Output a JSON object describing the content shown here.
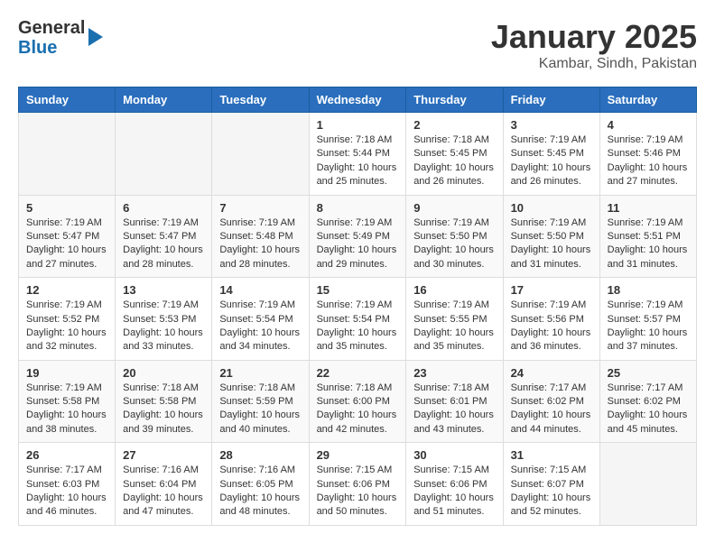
{
  "header": {
    "logo_general": "General",
    "logo_blue": "Blue",
    "title": "January 2025",
    "subtitle": "Kambar, Sindh, Pakistan"
  },
  "days_of_week": [
    "Sunday",
    "Monday",
    "Tuesday",
    "Wednesday",
    "Thursday",
    "Friday",
    "Saturday"
  ],
  "weeks": [
    [
      {
        "day": "",
        "info": ""
      },
      {
        "day": "",
        "info": ""
      },
      {
        "day": "",
        "info": ""
      },
      {
        "day": "1",
        "info": "Sunrise: 7:18 AM\nSunset: 5:44 PM\nDaylight: 10 hours\nand 25 minutes."
      },
      {
        "day": "2",
        "info": "Sunrise: 7:18 AM\nSunset: 5:45 PM\nDaylight: 10 hours\nand 26 minutes."
      },
      {
        "day": "3",
        "info": "Sunrise: 7:19 AM\nSunset: 5:45 PM\nDaylight: 10 hours\nand 26 minutes."
      },
      {
        "day": "4",
        "info": "Sunrise: 7:19 AM\nSunset: 5:46 PM\nDaylight: 10 hours\nand 27 minutes."
      }
    ],
    [
      {
        "day": "5",
        "info": "Sunrise: 7:19 AM\nSunset: 5:47 PM\nDaylight: 10 hours\nand 27 minutes."
      },
      {
        "day": "6",
        "info": "Sunrise: 7:19 AM\nSunset: 5:47 PM\nDaylight: 10 hours\nand 28 minutes."
      },
      {
        "day": "7",
        "info": "Sunrise: 7:19 AM\nSunset: 5:48 PM\nDaylight: 10 hours\nand 28 minutes."
      },
      {
        "day": "8",
        "info": "Sunrise: 7:19 AM\nSunset: 5:49 PM\nDaylight: 10 hours\nand 29 minutes."
      },
      {
        "day": "9",
        "info": "Sunrise: 7:19 AM\nSunset: 5:50 PM\nDaylight: 10 hours\nand 30 minutes."
      },
      {
        "day": "10",
        "info": "Sunrise: 7:19 AM\nSunset: 5:50 PM\nDaylight: 10 hours\nand 31 minutes."
      },
      {
        "day": "11",
        "info": "Sunrise: 7:19 AM\nSunset: 5:51 PM\nDaylight: 10 hours\nand 31 minutes."
      }
    ],
    [
      {
        "day": "12",
        "info": "Sunrise: 7:19 AM\nSunset: 5:52 PM\nDaylight: 10 hours\nand 32 minutes."
      },
      {
        "day": "13",
        "info": "Sunrise: 7:19 AM\nSunset: 5:53 PM\nDaylight: 10 hours\nand 33 minutes."
      },
      {
        "day": "14",
        "info": "Sunrise: 7:19 AM\nSunset: 5:54 PM\nDaylight: 10 hours\nand 34 minutes."
      },
      {
        "day": "15",
        "info": "Sunrise: 7:19 AM\nSunset: 5:54 PM\nDaylight: 10 hours\nand 35 minutes."
      },
      {
        "day": "16",
        "info": "Sunrise: 7:19 AM\nSunset: 5:55 PM\nDaylight: 10 hours\nand 35 minutes."
      },
      {
        "day": "17",
        "info": "Sunrise: 7:19 AM\nSunset: 5:56 PM\nDaylight: 10 hours\nand 36 minutes."
      },
      {
        "day": "18",
        "info": "Sunrise: 7:19 AM\nSunset: 5:57 PM\nDaylight: 10 hours\nand 37 minutes."
      }
    ],
    [
      {
        "day": "19",
        "info": "Sunrise: 7:19 AM\nSunset: 5:58 PM\nDaylight: 10 hours\nand 38 minutes."
      },
      {
        "day": "20",
        "info": "Sunrise: 7:18 AM\nSunset: 5:58 PM\nDaylight: 10 hours\nand 39 minutes."
      },
      {
        "day": "21",
        "info": "Sunrise: 7:18 AM\nSunset: 5:59 PM\nDaylight: 10 hours\nand 40 minutes."
      },
      {
        "day": "22",
        "info": "Sunrise: 7:18 AM\nSunset: 6:00 PM\nDaylight: 10 hours\nand 42 minutes."
      },
      {
        "day": "23",
        "info": "Sunrise: 7:18 AM\nSunset: 6:01 PM\nDaylight: 10 hours\nand 43 minutes."
      },
      {
        "day": "24",
        "info": "Sunrise: 7:17 AM\nSunset: 6:02 PM\nDaylight: 10 hours\nand 44 minutes."
      },
      {
        "day": "25",
        "info": "Sunrise: 7:17 AM\nSunset: 6:02 PM\nDaylight: 10 hours\nand 45 minutes."
      }
    ],
    [
      {
        "day": "26",
        "info": "Sunrise: 7:17 AM\nSunset: 6:03 PM\nDaylight: 10 hours\nand 46 minutes."
      },
      {
        "day": "27",
        "info": "Sunrise: 7:16 AM\nSunset: 6:04 PM\nDaylight: 10 hours\nand 47 minutes."
      },
      {
        "day": "28",
        "info": "Sunrise: 7:16 AM\nSunset: 6:05 PM\nDaylight: 10 hours\nand 48 minutes."
      },
      {
        "day": "29",
        "info": "Sunrise: 7:15 AM\nSunset: 6:06 PM\nDaylight: 10 hours\nand 50 minutes."
      },
      {
        "day": "30",
        "info": "Sunrise: 7:15 AM\nSunset: 6:06 PM\nDaylight: 10 hours\nand 51 minutes."
      },
      {
        "day": "31",
        "info": "Sunrise: 7:15 AM\nSunset: 6:07 PM\nDaylight: 10 hours\nand 52 minutes."
      },
      {
        "day": "",
        "info": ""
      }
    ]
  ]
}
